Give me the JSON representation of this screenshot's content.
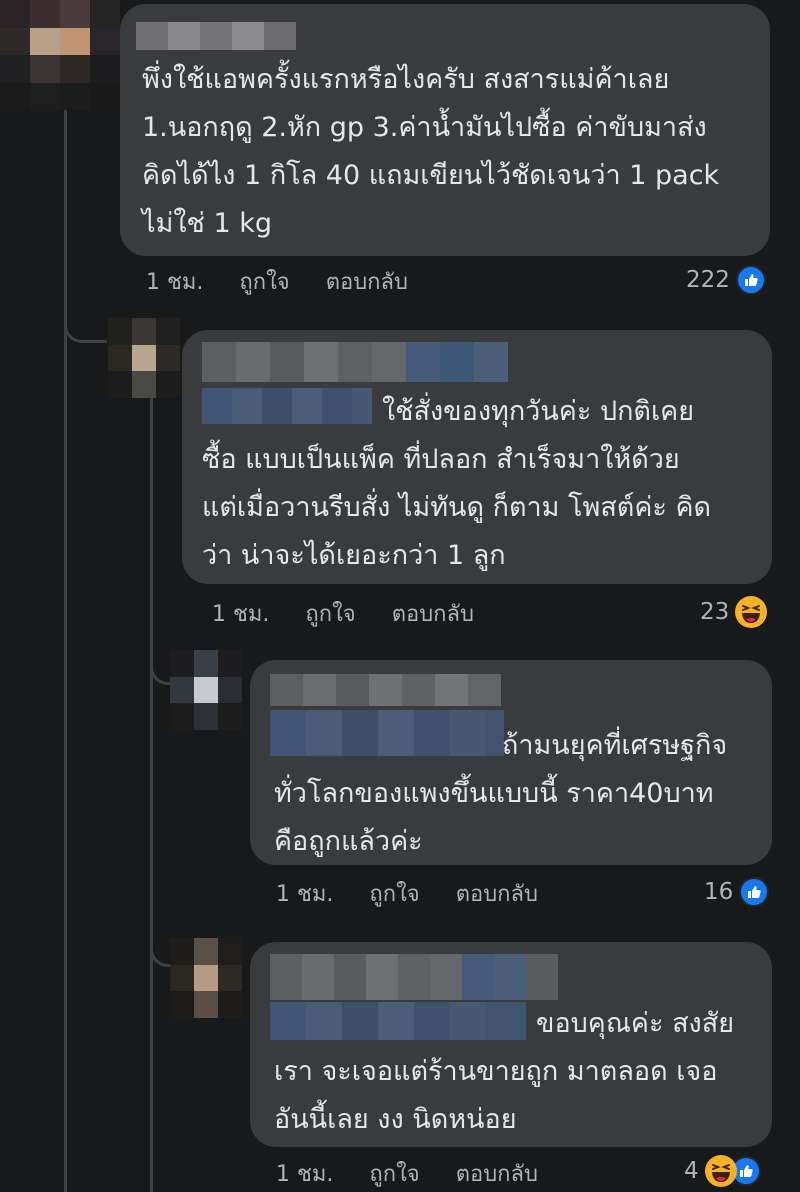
{
  "comments": [
    {
      "text_lines": [
        "พึ่งใช้แอพครั้งแรกหรือไงครับ สงสารแม่ค้าเลย",
        "1.นอกฤดู 2.หัก gp 3.ค่าน้ำมันไปซื้อ ค่าขับมาส่ง",
        "คิดได้ไง 1 กิโล 40 แถมเขียนไว้ชัดเจนว่า 1 pack",
        "ไม่ใช่ 1 kg"
      ],
      "time": "1 ชม.",
      "like_label": "ถูกใจ",
      "reply_label": "ตอบกลับ",
      "reaction_count": "222",
      "reactions": [
        "like-icon"
      ]
    },
    {
      "text_lines": [
        "ใช้สั่งของทุกวันค่ะ ปกติเคย",
        "ซื้อ แบบเป็นแพ็ค ที่ปลอก สำเร็จมาให้ด้วย",
        "แต่เมื่อวานรีบสั่ง ไม่ทันดู ก็ตาม โพสต์ค่ะ คิด",
        "ว่า น่าจะได้เยอะกว่า 1 ลูก"
      ],
      "time": "1 ชม.",
      "like_label": "ถูกใจ",
      "reply_label": "ตอบกลับ",
      "reaction_count": "23",
      "reactions": [
        "haha-icon"
      ]
    },
    {
      "text_lines": [
        "ถ้ามนยุคที่เศรษฐกิจ",
        "ทั่วโลกของแพงขึ้นแบบนี้ ราคา40บาท",
        "คือถูกแล้วค่ะ"
      ],
      "time": "1 ชม.",
      "like_label": "ถูกใจ",
      "reply_label": "ตอบกลับ",
      "reaction_count": "16",
      "reactions": [
        "like-icon"
      ]
    },
    {
      "text_lines": [
        "ขอบคุณค่ะ สงสัย",
        "เรา จะเจอแต่ร้านขายถูก มาตลอด เจอ",
        "อันนี้เลย งง นิดหน่อย"
      ],
      "time": "1 ชม.",
      "like_label": "ถูกใจ",
      "reply_label": "ตอบกลับ",
      "reaction_count": "4",
      "reactions": [
        "haha-icon",
        "like-icon"
      ]
    }
  ],
  "colors": {
    "background": "#18191a",
    "bubble": "#3a3b3c",
    "text": "#e4e6eb",
    "secondary_text": "#b0b3b8",
    "like_blue": "#1877f2",
    "haha_yellow": "#f7b125"
  }
}
